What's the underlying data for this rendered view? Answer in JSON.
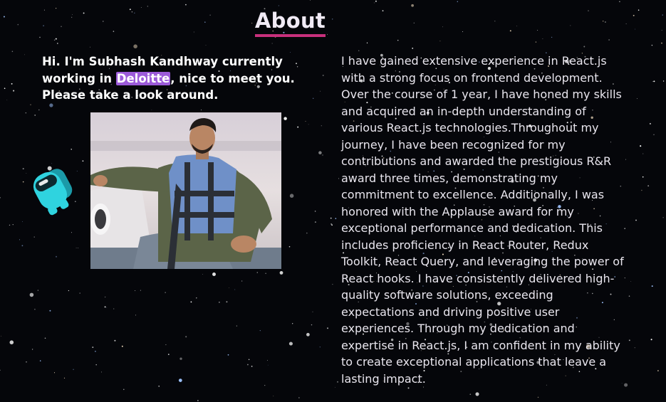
{
  "about": {
    "title": "About",
    "intro_before": "Hi. I'm Subhash Kandhway currently working in ",
    "intro_company": "Deloitte",
    "intro_after": ", nice to meet you. Please take a look around.",
    "bio": "I have gained extensive experience in React.js with a strong focus on frontend development. Over the course of 1 year, I have honed my skills and acquired an in-depth understanding of various React.js technologies.Throughout my journey, I have been recognized for my contributions and awarded the prestigious R&R award three times, demonstrating my commitment to excellence. Additionally, I was honored with the Applause award for my exceptional performance and dedication. This includes proficiency in React Router, Redux Toolkit, React Query, and leveraging the power of React hooks. I have consistently delivered high-quality software solutions, exceeding expectations and driving positive user experiences. Through my dedication and expertise in React.js, I am confident in my ability to create exceptional applications that leave a lasting impact."
  },
  "colors": {
    "background": "#05060a",
    "title_underline": "#c8307c",
    "highlight": "#9c5bd9",
    "astronaut": "#2fd3df"
  },
  "icons": {
    "astronaut": "astronaut-icon"
  }
}
